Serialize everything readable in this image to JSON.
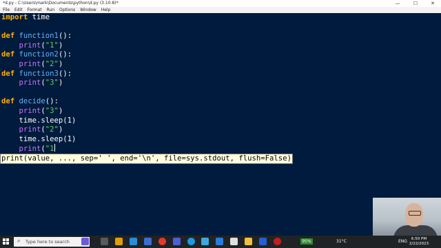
{
  "window": {
    "title": "*d.py - C:\\Users\\mark\\Documents\\python\\d.py (3.10.8)*",
    "controls": [
      "—",
      "☐",
      "✕"
    ]
  },
  "menubar": [
    "File",
    "Edit",
    "Format",
    "Run",
    "Options",
    "Window",
    "Help"
  ],
  "editor": {
    "lines": [
      [
        {
          "t": "import",
          "c": "kw"
        },
        {
          "t": " time",
          "c": "txt"
        }
      ],
      [],
      [
        {
          "t": "def",
          "c": "kw"
        },
        {
          "t": " ",
          "c": "txt"
        },
        {
          "t": "function1",
          "c": "fn"
        },
        {
          "t": "():",
          "c": "txt"
        }
      ],
      [
        {
          "t": "    ",
          "c": "txt"
        },
        {
          "t": "print",
          "c": "pr"
        },
        {
          "t": "(",
          "c": "txt"
        },
        {
          "t": "\"1\"",
          "c": "str"
        },
        {
          "t": ")",
          "c": "txt"
        }
      ],
      [
        {
          "t": "def",
          "c": "kw"
        },
        {
          "t": " ",
          "c": "txt"
        },
        {
          "t": "function2",
          "c": "fn"
        },
        {
          "t": "():",
          "c": "txt"
        }
      ],
      [
        {
          "t": "    ",
          "c": "txt"
        },
        {
          "t": "print",
          "c": "pr"
        },
        {
          "t": "(",
          "c": "txt"
        },
        {
          "t": "\"2\"",
          "c": "str"
        },
        {
          "t": ")",
          "c": "txt"
        }
      ],
      [
        {
          "t": "def",
          "c": "kw"
        },
        {
          "t": " ",
          "c": "txt"
        },
        {
          "t": "function3",
          "c": "fn"
        },
        {
          "t": "():",
          "c": "txt"
        }
      ],
      [
        {
          "t": "    ",
          "c": "txt"
        },
        {
          "t": "print",
          "c": "pr"
        },
        {
          "t": "(",
          "c": "txt"
        },
        {
          "t": "\"3\"",
          "c": "str"
        },
        {
          "t": ")",
          "c": "txt"
        }
      ],
      [],
      [
        {
          "t": "def",
          "c": "kw"
        },
        {
          "t": " ",
          "c": "txt"
        },
        {
          "t": "decide",
          "c": "fn"
        },
        {
          "t": "():",
          "c": "txt"
        }
      ],
      [
        {
          "t": "    ",
          "c": "txt"
        },
        {
          "t": "print",
          "c": "pr"
        },
        {
          "t": "(",
          "c": "txt"
        },
        {
          "t": "\"3\"",
          "c": "str"
        },
        {
          "t": ")",
          "c": "txt"
        }
      ],
      [
        {
          "t": "    time.sleep(1)",
          "c": "txt"
        }
      ],
      [
        {
          "t": "    ",
          "c": "txt"
        },
        {
          "t": "print",
          "c": "pr"
        },
        {
          "t": "(",
          "c": "txt"
        },
        {
          "t": "\"2\"",
          "c": "str"
        },
        {
          "t": ")",
          "c": "txt"
        }
      ],
      [
        {
          "t": "    time.sleep(1)",
          "c": "txt"
        }
      ],
      [
        {
          "t": "    ",
          "c": "txt"
        },
        {
          "t": "print",
          "c": "pr"
        },
        {
          "t": "(",
          "c": "txt"
        },
        {
          "t": "\"1",
          "c": "str"
        }
      ]
    ]
  },
  "calltip": "print(value, ..., sep=' ', end='\\n', file=sys.stdout, flush=False)",
  "taskbar": {
    "search_placeholder": "Type here to search",
    "badge": "95%",
    "weather": "31°C",
    "lang": "ENG",
    "time": "6:50 PM",
    "date": "2/22/2023"
  },
  "colors": {
    "editor_bg": "#001b3d",
    "keyword": "#ffb000",
    "function_name": "#66b3ff",
    "string": "#5fd35f",
    "builtin": "#d070ff"
  }
}
